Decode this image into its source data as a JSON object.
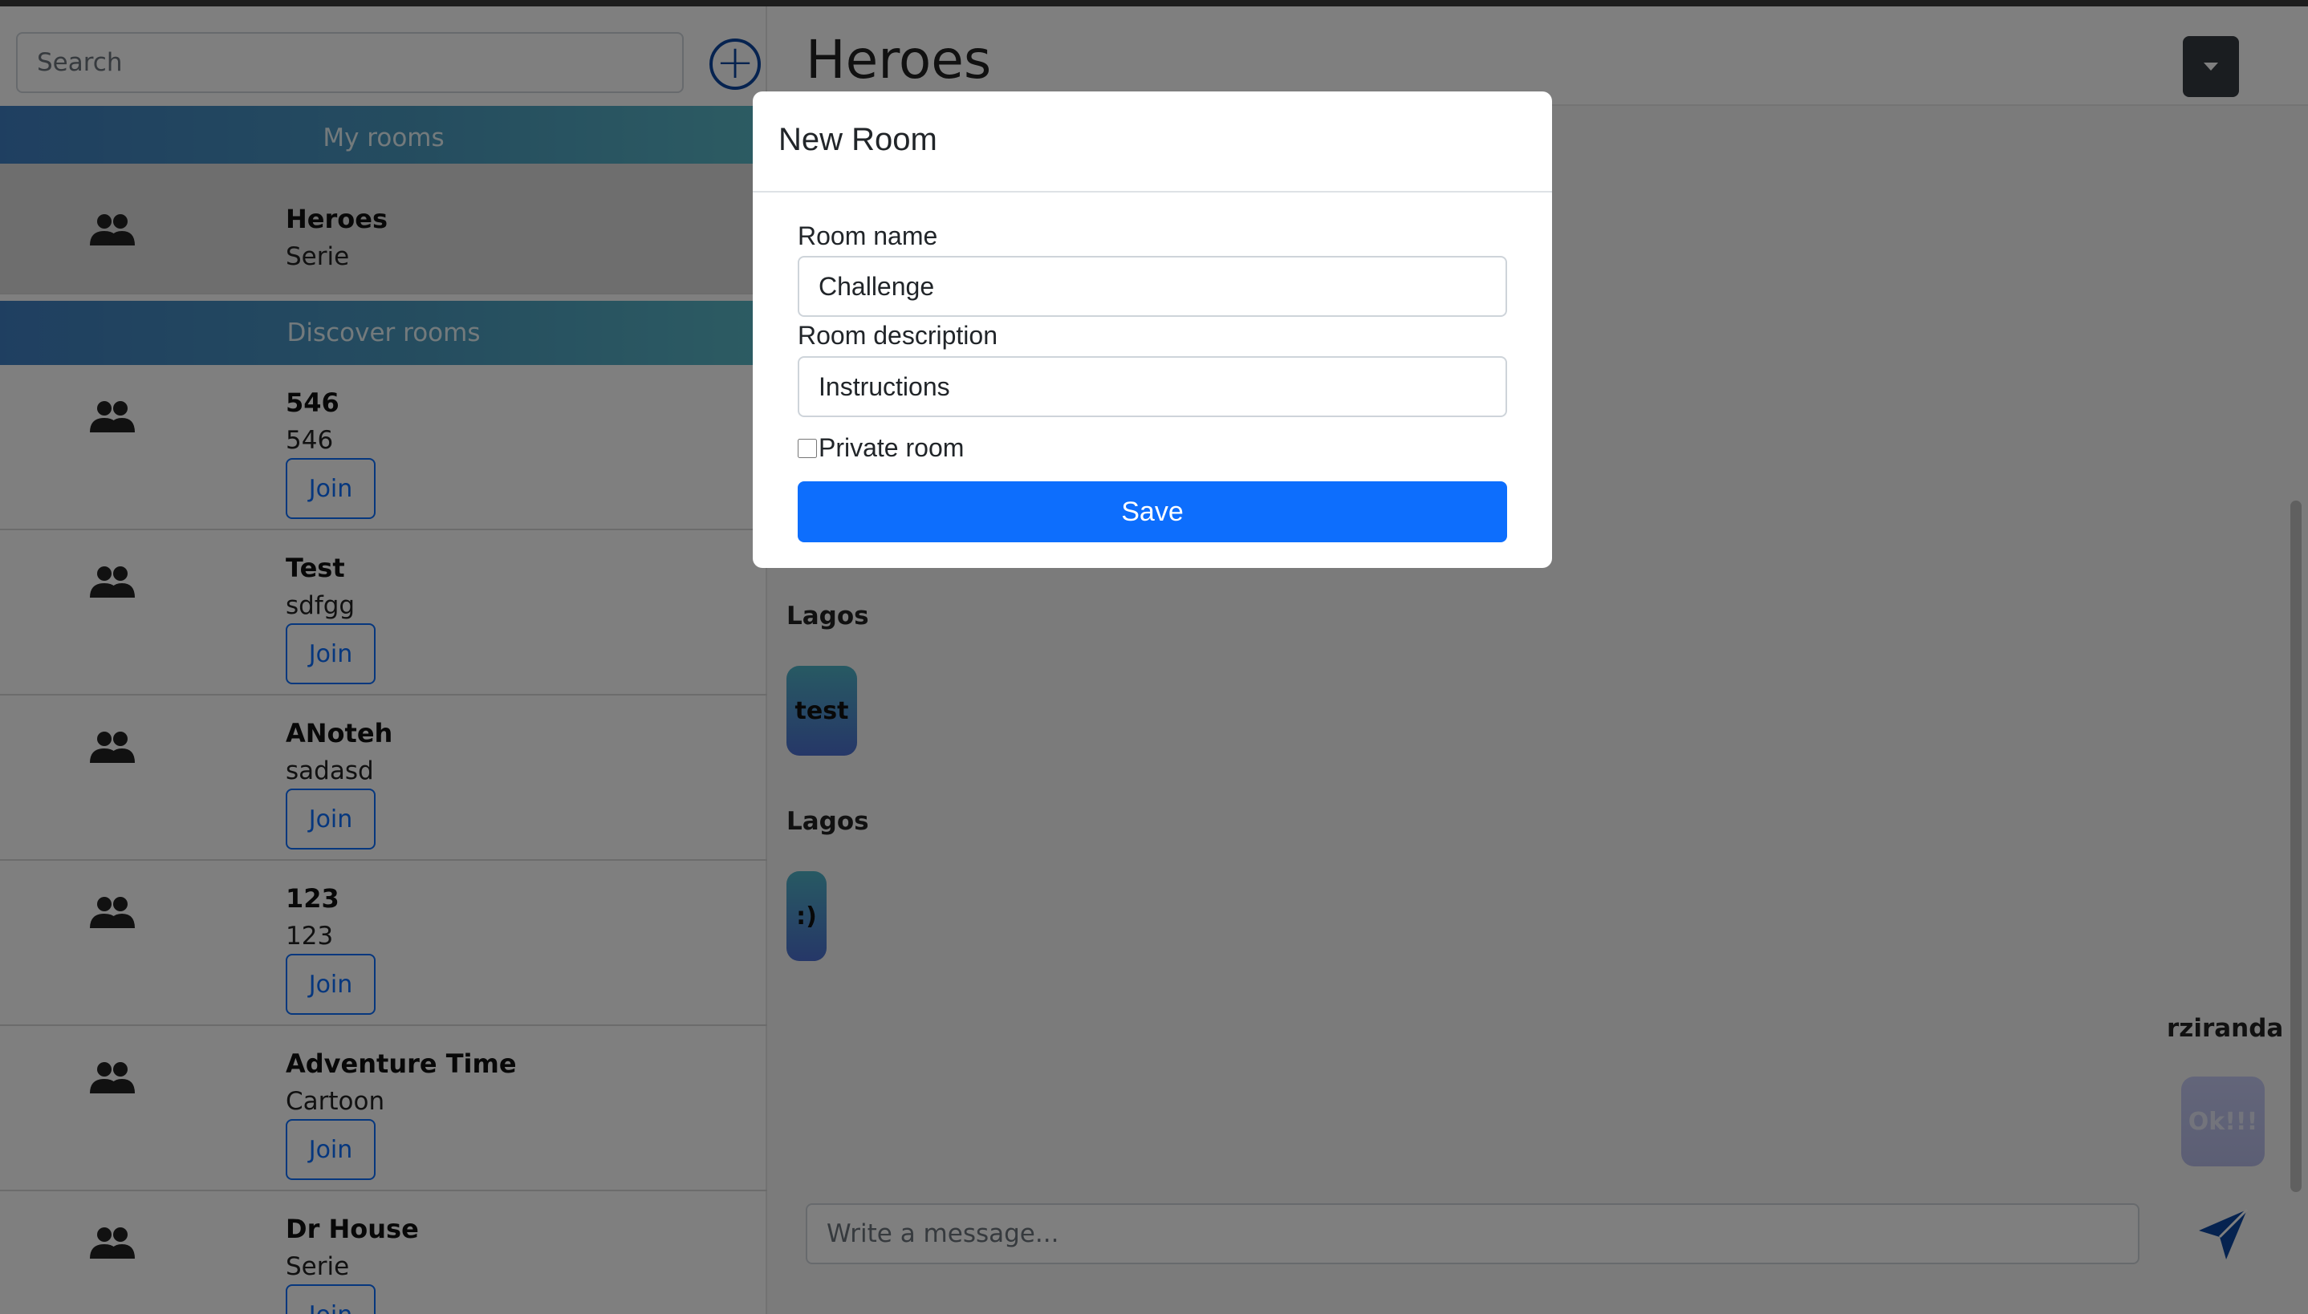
{
  "sidebar": {
    "search": {
      "placeholder": "Search",
      "value": ""
    },
    "add_button_icon": "plus-circle-icon",
    "my_rooms_header": "My rooms",
    "my_rooms": [
      {
        "name": "Heroes",
        "description": "Serie"
      }
    ],
    "discover_header": "Discover rooms",
    "join_label": "Join",
    "discover_rooms": [
      {
        "name": "546",
        "description": "546"
      },
      {
        "name": "Test",
        "description": "sdfgg"
      },
      {
        "name": "ANoteh",
        "description": "sadasd"
      },
      {
        "name": "123",
        "description": "123"
      },
      {
        "name": "Adventure Time",
        "description": "Cartoon"
      },
      {
        "name": "Dr House",
        "description": "Serie"
      }
    ]
  },
  "main": {
    "title": "Heroes",
    "messages": [
      {
        "author": "Lagos",
        "text": "test"
      },
      {
        "author": "Lagos",
        "text": ":)"
      },
      {
        "author": "rziranda",
        "text": "Ok!!!"
      }
    ],
    "message_input": {
      "placeholder": "Write a message...",
      "value": ""
    }
  },
  "modal": {
    "title": "New Room",
    "room_name_label": "Room name",
    "room_name_value": "Challenge",
    "room_description_label": "Room description",
    "room_description_value": "Instructions",
    "private_label": "Private room",
    "private_checked": false,
    "save_label": "Save"
  },
  "colors": {
    "primary": "#0d6efd",
    "dark_button": "#343a40",
    "header_gradient_start": "#3f7fc2",
    "header_gradient_end": "#5ab8c6",
    "bubble_gradient_start": "#4fb3c6",
    "bubble_gradient_end": "#4d6fd0"
  }
}
